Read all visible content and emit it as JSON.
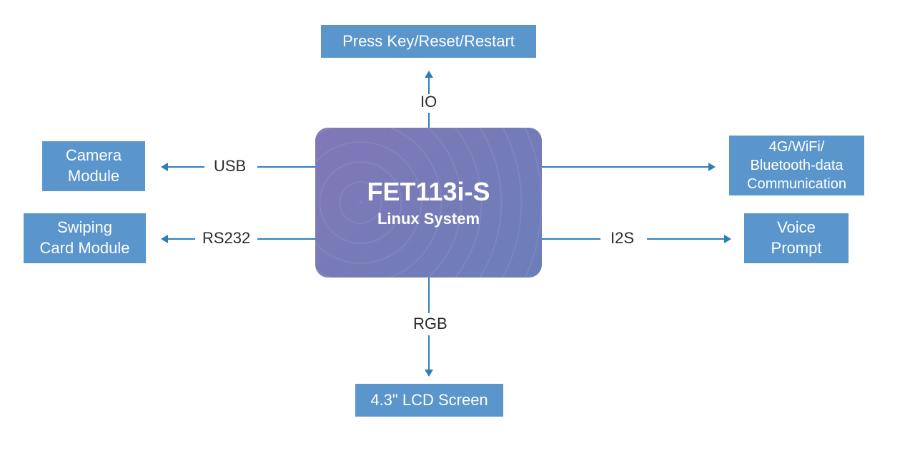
{
  "center": {
    "title": "FET113i-S",
    "subtitle": "Linux System"
  },
  "nodes": {
    "top": "Press Key/Reset/Restart",
    "bottom": "4.3\" LCD Screen",
    "left_upper": "Camera\nModule",
    "left_lower": "Swiping\nCard Module",
    "right_upper": "4G/WiFi/\nBluetooth-data\nCommunication",
    "right_lower": "Voice\nPrompt"
  },
  "labels": {
    "top": "IO",
    "bottom": "RGB",
    "left_upper": "USB",
    "left_lower": "RS232",
    "right_lower": "I2S"
  }
}
